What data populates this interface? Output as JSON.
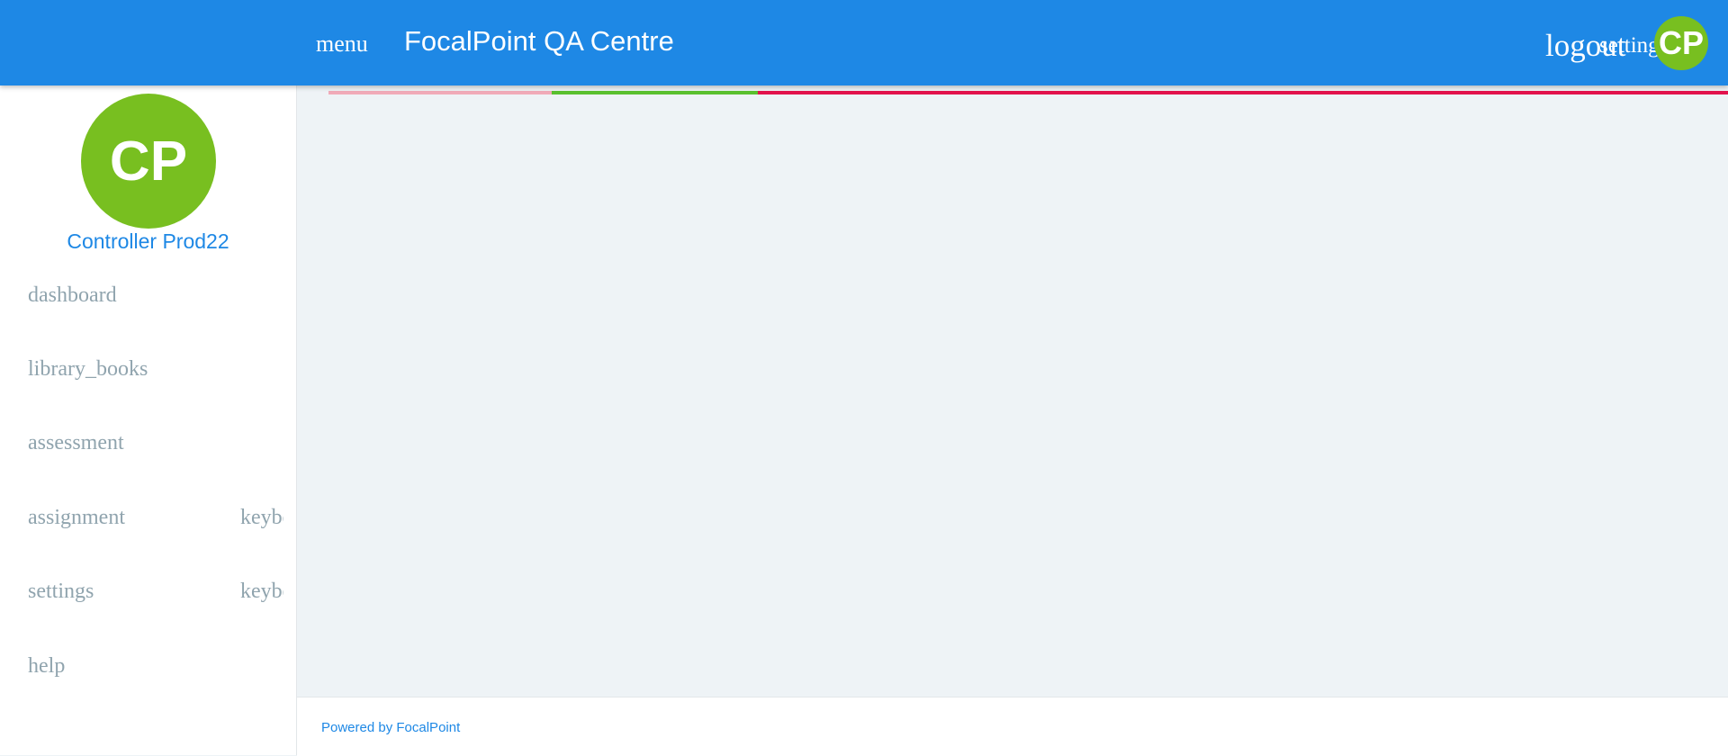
{
  "header": {
    "menu_label": "menu",
    "title": "FocalPoint QA Centre",
    "logout_label": "logout",
    "settings_label": "settings",
    "avatar_initials": "CP",
    "background_color": "#1e88e5"
  },
  "progress_bar": {
    "segment_colors": [
      "#f1aab8",
      "#5ac02e",
      "#e2134c"
    ]
  },
  "sidebar": {
    "avatar_initials": "CP",
    "avatar_color": "#78bf20",
    "user_name": "Controller Prod22",
    "items": [
      {
        "label": "dashboard",
        "key": ""
      },
      {
        "label": "library_books",
        "key": ""
      },
      {
        "label": "assessment",
        "key": ""
      },
      {
        "label": "assignment",
        "key": "keyboard_arrow_right"
      },
      {
        "label": "settings",
        "key": "keyboard_arrow_right"
      },
      {
        "label": "help",
        "key": ""
      }
    ]
  },
  "footer": {
    "powered_by": "Powered by FocalPoint"
  }
}
